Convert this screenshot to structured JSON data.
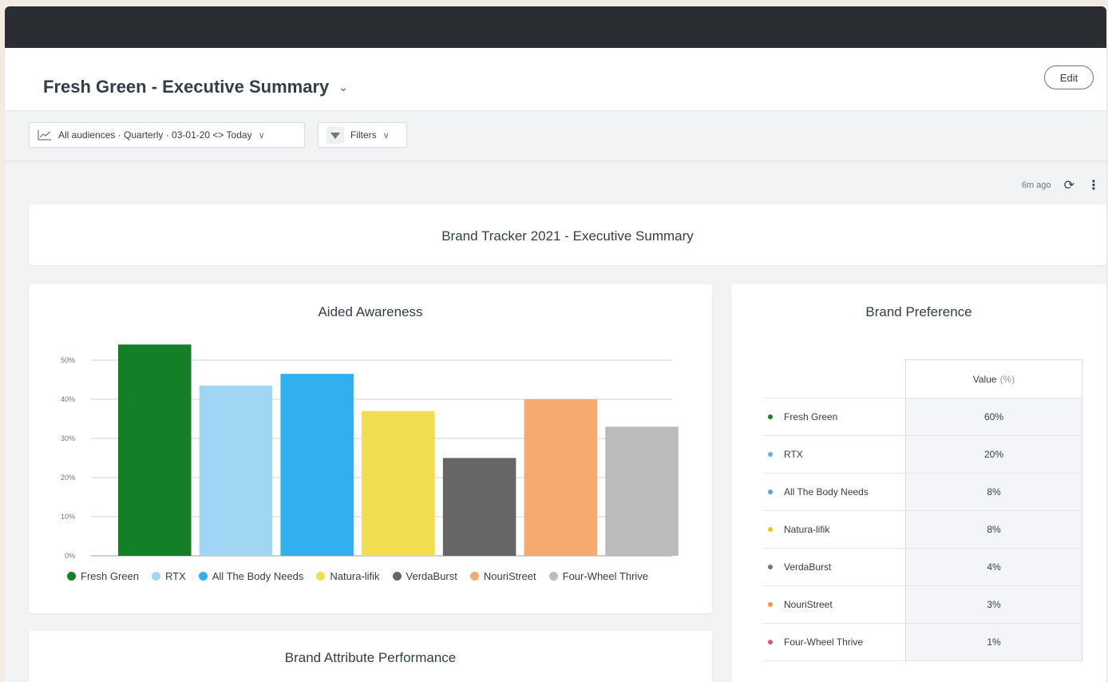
{
  "header": {
    "title": "Fresh Green - Executive Summary",
    "edit_label": "Edit"
  },
  "filterbar": {
    "audience_label": "All audiences · Quarterly · 03-01-20 <> Today",
    "filters_label": "Filters"
  },
  "meta": {
    "updated": "6m ago"
  },
  "summary": {
    "title": "Brand Tracker 2021 - Executive Summary"
  },
  "awareness": {
    "title": "Aided Awareness"
  },
  "chart_data": {
    "type": "bar",
    "title": "Aided Awareness",
    "categories": [
      "Fresh Green",
      "RTX",
      "All The Body Needs",
      "Natura-lifik",
      "VerdaBurst",
      "NouriStreet",
      "Four-Wheel Thrive"
    ],
    "values": [
      54,
      43.5,
      46.5,
      37,
      25,
      40,
      33
    ],
    "colors": [
      "#137f26",
      "#a0d5f4",
      "#30b0ef",
      "#f2dc50",
      "#666666",
      "#f6aa6e",
      "#bbbbbb"
    ],
    "yticks": [
      "0%",
      "10%",
      "20%",
      "30%",
      "40%",
      "50%"
    ],
    "ylim": [
      0,
      50
    ],
    "grid": true,
    "legend": "bottom"
  },
  "preference": {
    "title": "Brand Preference",
    "value_header": "Value",
    "value_unit": "(%)",
    "rows": [
      {
        "name": "Fresh Green",
        "value": "60%",
        "color": "#137f26"
      },
      {
        "name": "RTX",
        "value": "20%",
        "color": "#5bb7d6"
      },
      {
        "name": "All The Body Needs",
        "value": "8%",
        "color": "#4fa8cf"
      },
      {
        "name": "Natura-lifik",
        "value": "8%",
        "color": "#e8c80b"
      },
      {
        "name": "VerdaBurst",
        "value": "4%",
        "color": "#777777"
      },
      {
        "name": "NouriStreet",
        "value": "3%",
        "color": "#f2973c"
      },
      {
        "name": "Four-Wheel Thrive",
        "value": "1%",
        "color": "#d85a78"
      }
    ]
  },
  "attributes": {
    "title": "Brand Attribute Performance"
  }
}
